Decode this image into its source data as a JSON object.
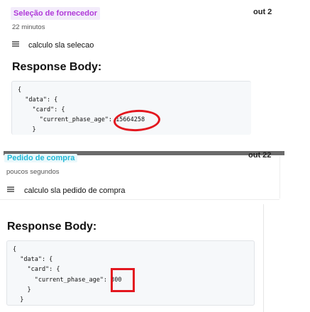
{
  "card1": {
    "phase": "Seleção de fornecedor",
    "date": "out 2",
    "time_ago": "22 minutos",
    "description": "calculo sla selecao",
    "response_title": "Response Body:",
    "code": [
      "{",
      "  \"data\": {",
      "    \"card\": {",
      "      \"current_phase_age\": 15664258",
      "    }"
    ]
  },
  "card2": {
    "phase": "Pedido de compra",
    "date": "out 22",
    "time_ago": "poucos segundos",
    "description": "calculo sla pedido de compra",
    "response_title": "Response Body:",
    "code": [
      "{",
      "  \"data\": {",
      "    \"card\": {",
      "      \"current_phase_age\": 300",
      "    }",
      "  }"
    ]
  },
  "annotations": {
    "color": "#e3171f",
    "shapes": [
      "ellipse",
      "rectangle"
    ]
  },
  "icons": [
    "list-lines-icon"
  ]
}
